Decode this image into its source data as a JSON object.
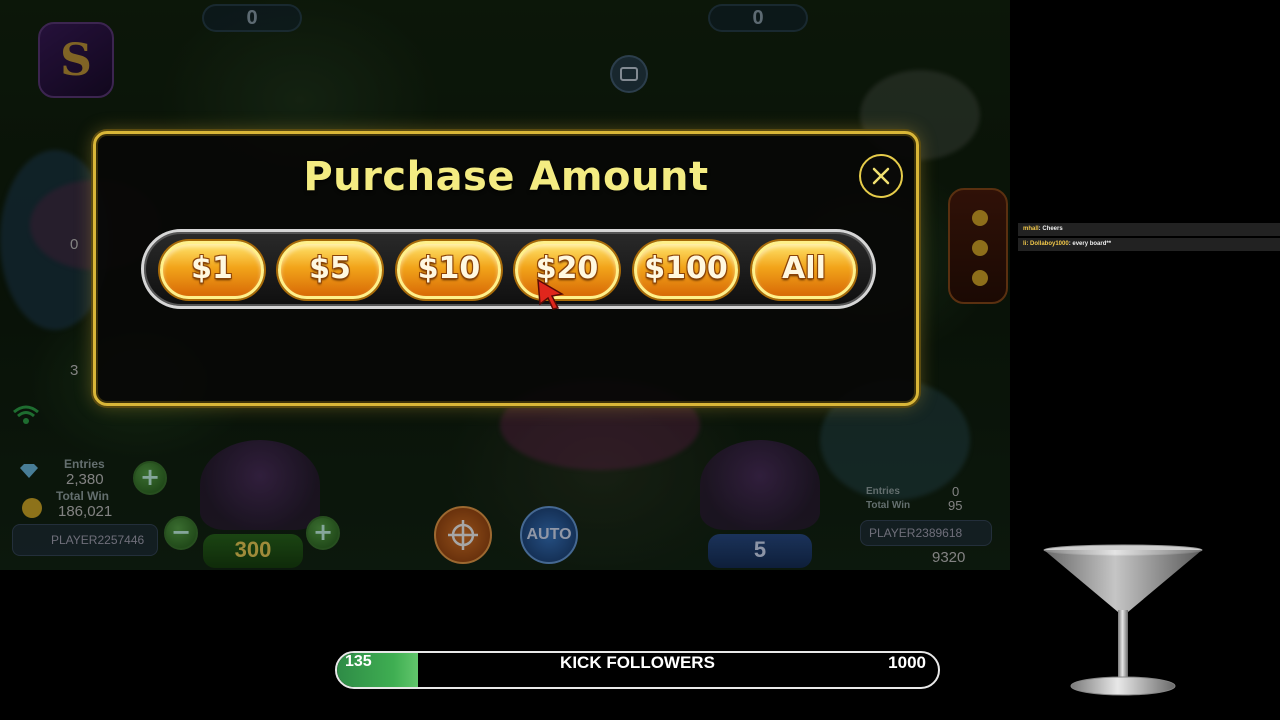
{
  "game": {
    "top_left_counter": "0",
    "top_right_counter": "0",
    "logo_letter": "S",
    "left_panel": {
      "side_counter_1": "0",
      "side_counter_2": "3",
      "entries_label": "Entries",
      "entries_value": "2,380",
      "total_win_label": "Total Win",
      "total_win_value": "186,021",
      "player_name": "PLAYER2257446",
      "bet_value": "300",
      "minus_symbol": "−",
      "plus_symbol": "+"
    },
    "center": {
      "auto_label": "AUTO",
      "bet_value": "5"
    },
    "right_panel": {
      "entries_label": "Entries",
      "entries_value": "0",
      "total_win_label": "Total Win",
      "total_win_value": "95",
      "player_name": "PLAYER2389618",
      "score_partial": "9320"
    }
  },
  "dialog": {
    "title": "Purchase Amount",
    "amounts": [
      "$1",
      "$5",
      "$10",
      "$20",
      "$100",
      "All"
    ],
    "hovered_amount": "$20"
  },
  "chat": {
    "messages": [
      {
        "user": "mhall",
        "text": ": Cheers"
      },
      {
        "user": "li: Dollaboy1000",
        "text": ": every board**"
      }
    ]
  },
  "followers": {
    "label": "KICK FOLLOWERS",
    "current": "135",
    "goal": "1000",
    "progress": 0.135
  },
  "colors": {
    "dialog_border": "#d9b638",
    "title_text": "#f4ec82",
    "button_gold": "#f2a41a",
    "progress_green": "#3fae52"
  }
}
